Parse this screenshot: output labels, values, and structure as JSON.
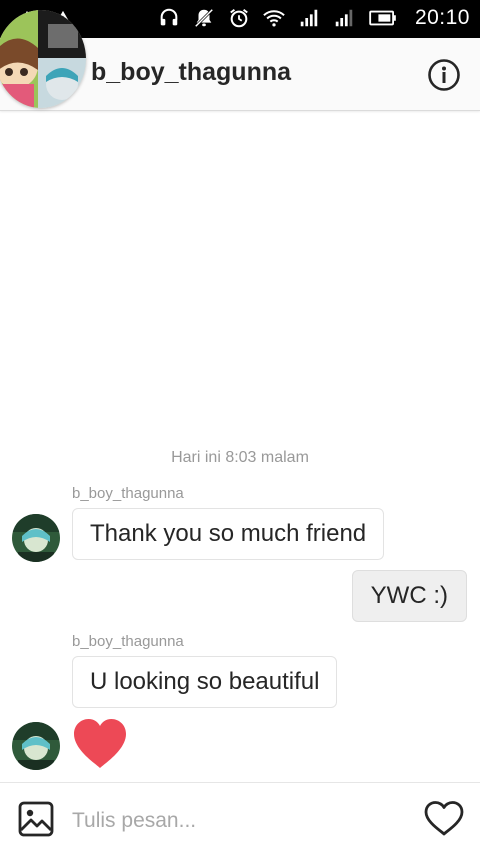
{
  "status_bar": {
    "time": "20:10",
    "icons": [
      "warning-icon",
      "warning-icon",
      "headset-icon",
      "notifications-off-icon",
      "alarm-icon",
      "wifi-icon",
      "signal-icon",
      "signal-icon",
      "battery-icon"
    ]
  },
  "header": {
    "username": "b_boy_thagunna",
    "info_icon": "info-icon"
  },
  "thread": {
    "timestamp": "Hari ini 8:03 malam",
    "messages": [
      {
        "sender": "b_boy_thagunna",
        "text": "Thank you so much friend",
        "direction": "incoming"
      },
      {
        "text": "YWC :)",
        "direction": "outgoing"
      },
      {
        "sender": "b_boy_thagunna",
        "text": "U looking so beautiful",
        "direction": "incoming"
      },
      {
        "type": "like",
        "icon": "heart-icon",
        "color": "#ed4956",
        "direction": "incoming"
      }
    ]
  },
  "composer": {
    "placeholder": "Tulis pesan...",
    "value": "",
    "gallery_icon": "gallery-icon",
    "like_icon": "heart-outline-icon"
  },
  "colors": {
    "heart": "#ed4956",
    "text": "#262626",
    "muted": "#999999",
    "outgoing_bubble": "#efefef"
  }
}
